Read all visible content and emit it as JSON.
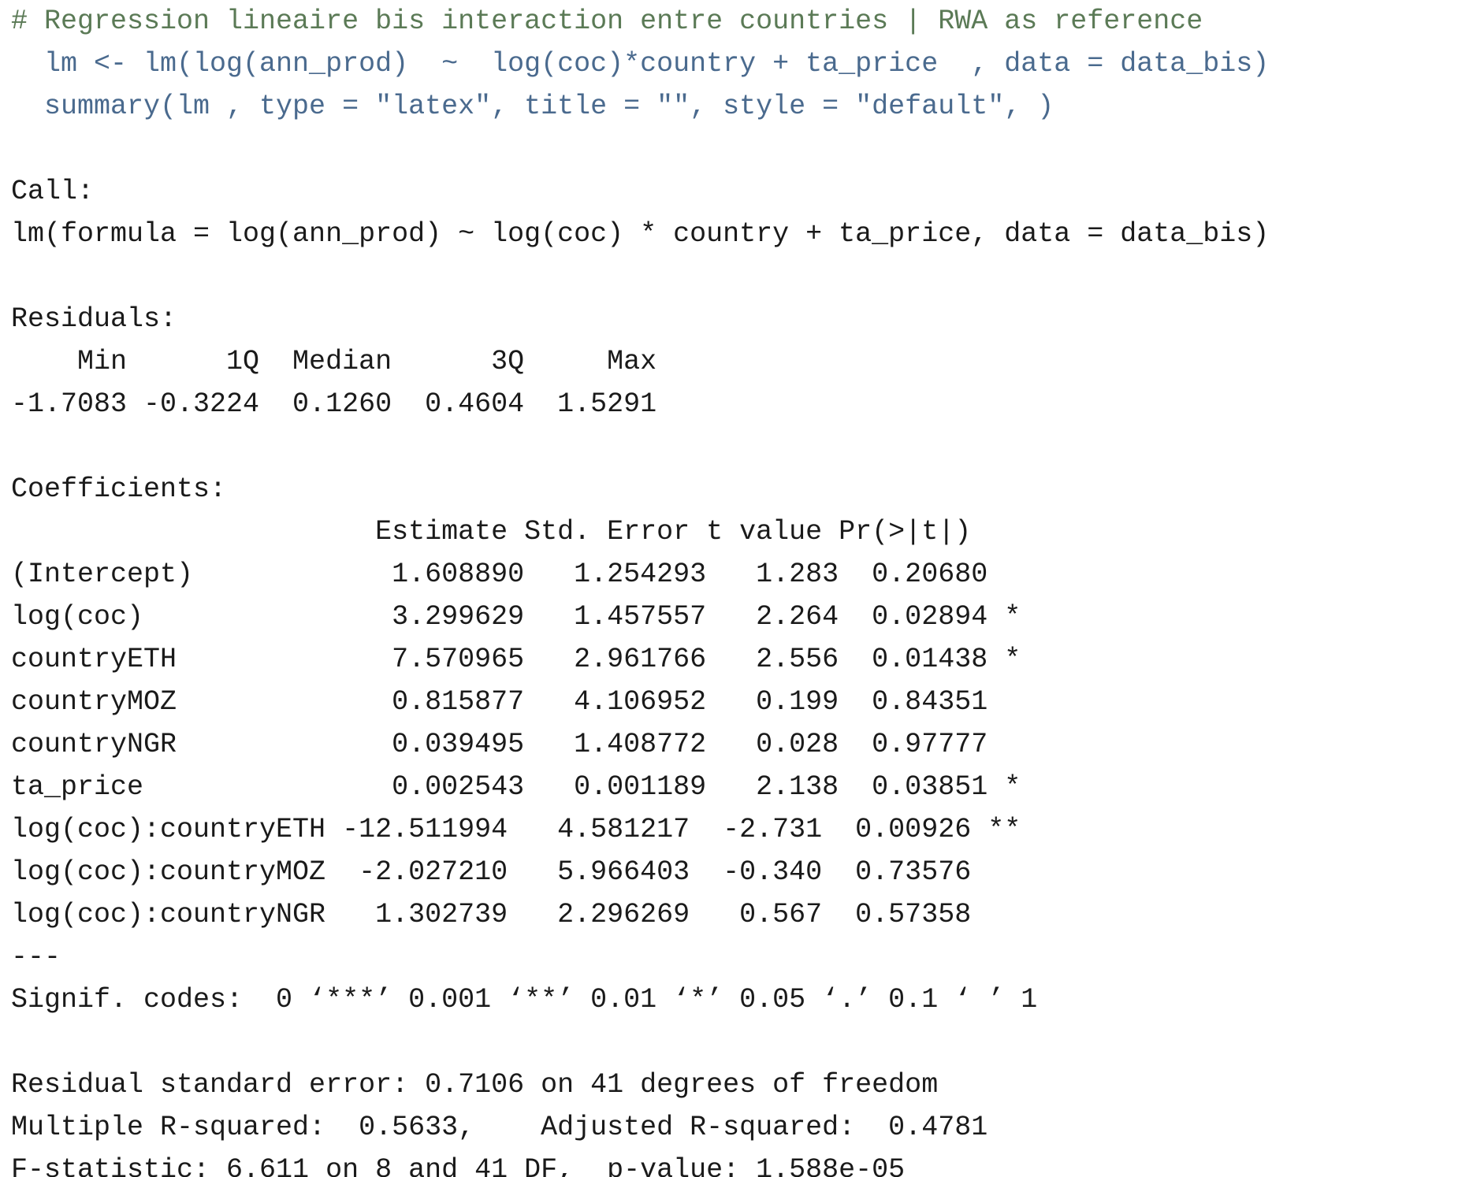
{
  "colors": {
    "comment": "#5b7a56",
    "code": "#4a6a8e",
    "output": "#1a1a1a",
    "background": "#ffffff"
  },
  "code": {
    "comment": "# Regression lineaire bis interaction entre countries | RWA as reference",
    "lm_call": "  lm <- lm(log(ann_prod)  ~  log(coc)*country + ta_price  , data = data_bis)",
    "summary_call": "  summary(lm , type = \"latex\", title = \"\", style = \"default\", )"
  },
  "output": {
    "call_header": "Call:",
    "call_formula": "lm(formula = log(ann_prod) ~ log(coc) * country + ta_price, data = data_bis)",
    "residuals_header": "Residuals:",
    "residuals_labels": "    Min      1Q  Median      3Q     Max ",
    "residuals_values": "-1.7083 -0.3224  0.1260  0.4604  1.5291 ",
    "coefficients_header": "Coefficients:",
    "coef_col_header": "                      Estimate Std. Error t value Pr(>|t|)   ",
    "coef_rows": [
      "(Intercept)            1.608890   1.254293   1.283  0.20680   ",
      "log(coc)               3.299629   1.457557   2.264  0.02894 * ",
      "countryETH             7.570965   2.961766   2.556  0.01438 * ",
      "countryMOZ             0.815877   4.106952   0.199  0.84351   ",
      "countryNGR             0.039495   1.408772   0.028  0.97777   ",
      "ta_price               0.002543   0.001189   2.138  0.03851 * ",
      "log(coc):countryETH -12.511994   4.581217  -2.731  0.00926 **",
      "log(coc):countryMOZ  -2.027210   5.966403  -0.340  0.73576   ",
      "log(coc):countryNGR   1.302739   2.296269   0.567  0.57358   "
    ],
    "separator": "---",
    "signif_codes": "Signif. codes:  0 ‘***’ 0.001 ‘**’ 0.01 ‘*’ 0.05 ‘.’ 0.1 ‘ ’ 1",
    "rse": "Residual standard error: 0.7106 on 41 degrees of freedom",
    "r_squared": "Multiple R-squared:  0.5633,\tAdjusted R-squared:  0.4781 ",
    "f_statistic": "F-statistic: 6.611 on 8 and 41 DF,  p-value: 1.588e-05"
  }
}
